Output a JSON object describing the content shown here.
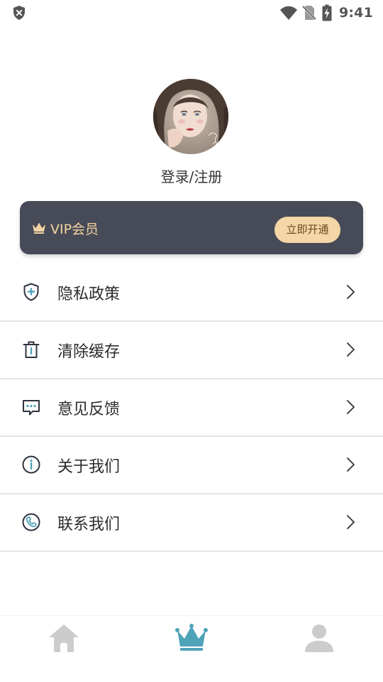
{
  "status_bar": {
    "time": "9:41",
    "icons": [
      "shield-x-icon",
      "wifi-icon",
      "no-sim-icon",
      "battery-charging-icon"
    ]
  },
  "profile": {
    "login_text": "登录/注册",
    "avatar": "avatar-image"
  },
  "vip": {
    "label": "VIP会员",
    "button_label": "立即开通",
    "icon": "crown-icon",
    "colors": {
      "card_bg": "#474b57",
      "label": "#f2d3a2",
      "button_bg": "#f5d6a6",
      "button_text": "#6a4a20"
    }
  },
  "menu": {
    "items": [
      {
        "label": "隐私政策",
        "icon": "shield-plus-icon"
      },
      {
        "label": "清除缓存",
        "icon": "trash-icon"
      },
      {
        "label": "意见反馈",
        "icon": "chat-bubble-icon"
      },
      {
        "label": "关于我们",
        "icon": "info-icon"
      },
      {
        "label": "联系我们",
        "icon": "phone-icon"
      }
    ]
  },
  "bottom_nav": {
    "tabs": [
      {
        "icon": "home-icon",
        "active": false
      },
      {
        "icon": "crown-icon",
        "active": true
      },
      {
        "icon": "user-icon",
        "active": false
      }
    ],
    "colors": {
      "active": "#4fa3b8",
      "inactive": "#cccccc"
    }
  }
}
